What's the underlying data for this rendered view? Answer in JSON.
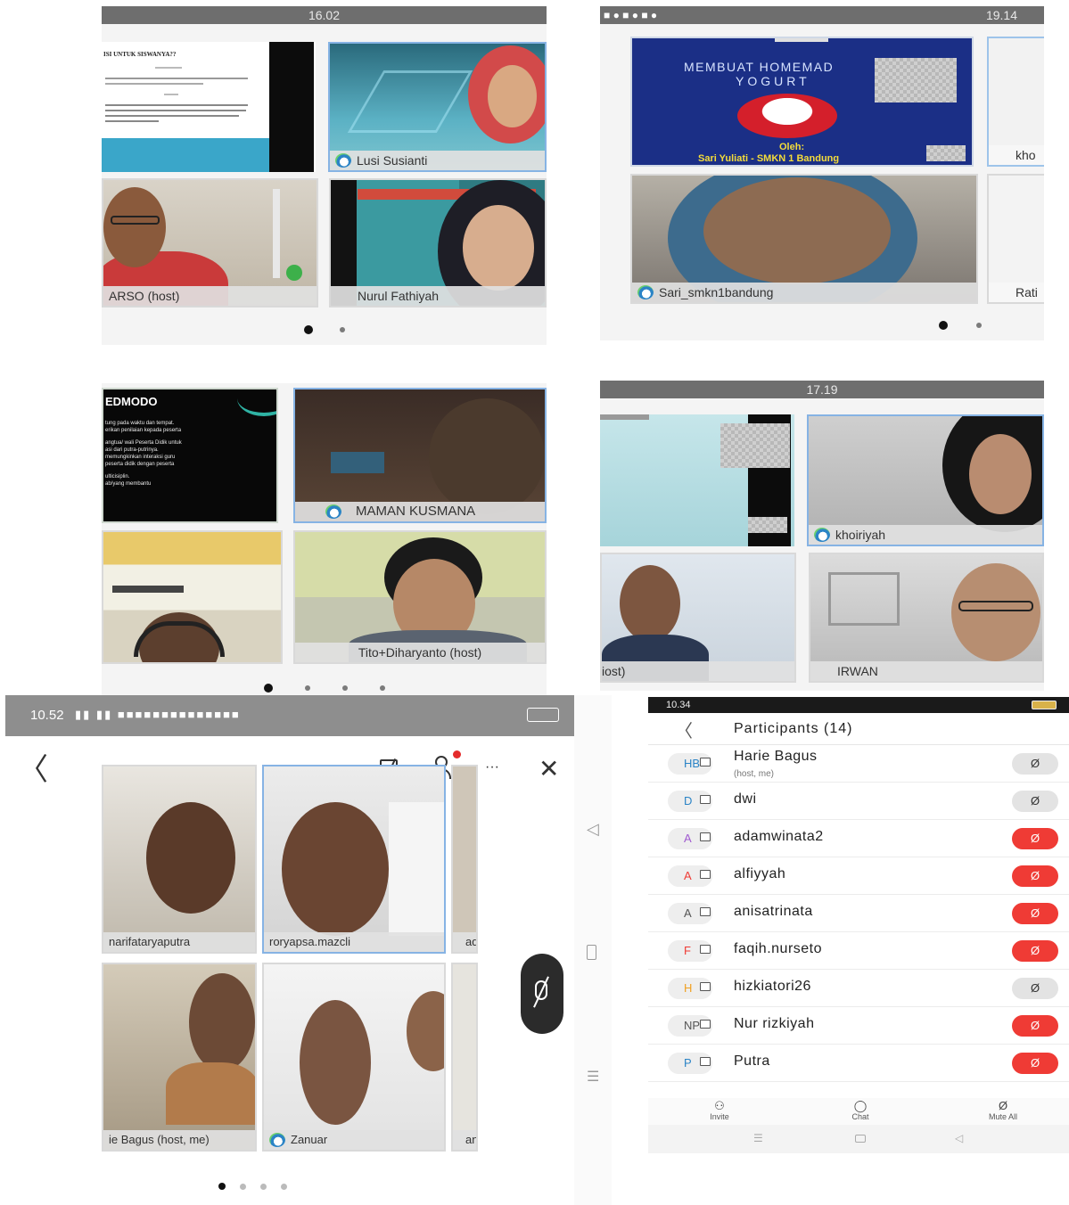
{
  "panel1": {
    "time": "16.02",
    "slide_title": "ISI UNTUK SISWANYA??",
    "tiles": [
      {
        "name": "Lusi Susianti"
      },
      {
        "name": "ARSO (host)"
      },
      {
        "name": "Nurul Fathiyah"
      }
    ]
  },
  "panel2": {
    "time": "19.14",
    "slide_title_1": "MEMBUAT HOMEMAD",
    "slide_title_2": "YOGURT",
    "slide_by": "Oleh:",
    "slide_author": "Sari Yuliati - SMKN 1 Bandung",
    "tiles": [
      {
        "name": "kho"
      },
      {
        "name": "Sari_smkn1bandung"
      },
      {
        "name": "Rati"
      }
    ]
  },
  "panel3": {
    "slide_title": "EDMODO",
    "slide_lines": [
      "tung pada waktu dan tempat.",
      "erikan penilaian kepada peserta",
      "",
      "angtua/ wali Peserta Didik untuk",
      "asi dari putra-putrinya.",
      "memungkinkan interaksi guru",
      "peserta didik dengan peserta",
      "",
      "ulticisiplin.",
      "ab/yang membantu"
    ],
    "tiles": [
      {
        "name": "MAMAN KUSMANA"
      },
      {
        "name": "Tito+Diharyanto (host)"
      }
    ]
  },
  "panel4": {
    "time": "17.19",
    "tiles": [
      {
        "name": "khoiriyah"
      },
      {
        "name": "iost)"
      },
      {
        "name": "IRWAN"
      }
    ]
  },
  "panel5": {
    "status_time": "10.52",
    "tiles": [
      {
        "name": "narifataryaputra"
      },
      {
        "name": "roryapsa.mazcli"
      },
      {
        "name": "ada"
      },
      {
        "name": "ie Bagus (host, me)"
      },
      {
        "name": "Zanuar"
      },
      {
        "name": "anis"
      }
    ],
    "more_label": "···"
  },
  "panel6": {
    "status_time": "10.34",
    "title": "Participants (14)",
    "participants": [
      {
        "initials": "HB",
        "name": "Harie Bagus",
        "sub": "(host, me)",
        "muted": false
      },
      {
        "initials": "D",
        "name": "dwi",
        "sub": "",
        "muted": false
      },
      {
        "initials": "A",
        "name": "adamwinata2",
        "sub": "",
        "muted": true
      },
      {
        "initials": "A",
        "name": "alfiyyah",
        "sub": "",
        "muted": true
      },
      {
        "initials": "A",
        "name": "anisatrinata",
        "sub": "",
        "muted": true
      },
      {
        "initials": "F",
        "name": "faqih.nurseto",
        "sub": "",
        "muted": true
      },
      {
        "initials": "H",
        "name": "hizkiatori26",
        "sub": "",
        "muted": false
      },
      {
        "initials": "NP",
        "name": "Nur rizkiyah",
        "sub": "",
        "muted": true
      },
      {
        "initials": "P",
        "name": "Putra",
        "sub": "",
        "muted": true
      }
    ],
    "bottom": {
      "invite": "Invite",
      "chat": "Chat",
      "mute_all": "Mute All"
    }
  },
  "colors": {
    "muted": "#ef3b35",
    "namebar": "#e1e1e1",
    "accent_border": "#86b3e4"
  }
}
